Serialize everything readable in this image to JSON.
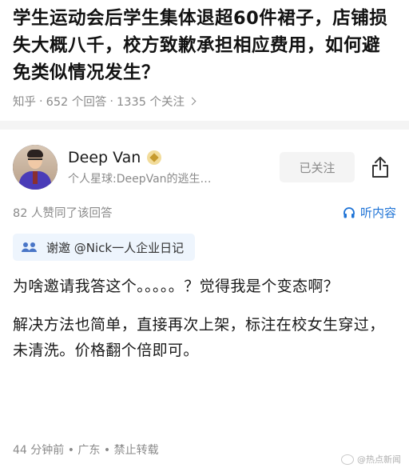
{
  "question": {
    "title": "学生运动会后学生集体退超60件裙子，店铺损失大概八千，校方致歉承担相应费用，如何避免类似情况发生？",
    "meta": {
      "site": "知乎",
      "answers": "652 个回答",
      "followers": "1335 个关注"
    }
  },
  "answer": {
    "author": {
      "name": "Deep Van",
      "bio": "个人星球:DeepVan的逃生…"
    },
    "follow_label": "已关注",
    "likes": "82 人赞同了该回答",
    "listen_label": "听内容",
    "invite": "谢邀 @Nick一人企业日记",
    "paragraphs": [
      "为啥邀请我答这个。。。。。？觉得我是个变态啊？",
      "解决方法也简单，直接再次上架，标注在校女生穿过，未清洗。价格翻个倍即可。"
    ],
    "footer": "44 分钟前 • 广东 • 禁止转载"
  },
  "watermark": "@热点新闻"
}
